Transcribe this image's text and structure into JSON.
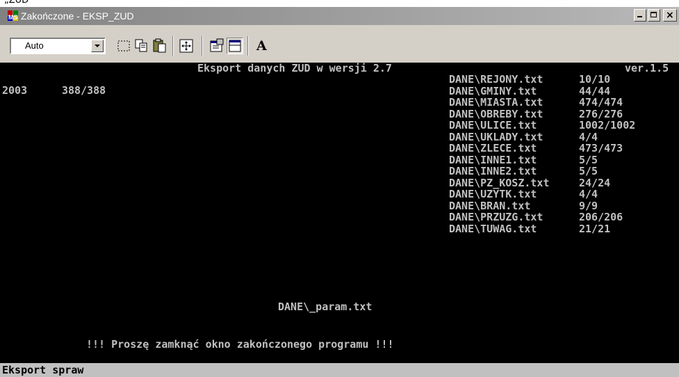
{
  "caption": "„ZUD",
  "window": {
    "title": "Zakończone - EKSP_ZUD",
    "minimize_glyph": "_",
    "maximize_glyph": "□",
    "close_glyph": "×",
    "app_icon": "ms-dos-icon"
  },
  "toolbar": {
    "font_size_value": "Auto",
    "dropdown_icon": "chevron-down-icon",
    "tools": [
      {
        "name": "mark-icon"
      },
      {
        "name": "copy-icon"
      },
      {
        "name": "paste-icon"
      },
      {
        "name": "fullscreen-icon"
      },
      {
        "name": "properties-icon"
      },
      {
        "name": "background-icon"
      },
      {
        "name": "font-icon",
        "glyph": "A"
      }
    ]
  },
  "console": {
    "header": "Eksport danych ZUD w wersji 2.7",
    "version": "ver.1.5",
    "year": "2003",
    "year_count": "388/388",
    "files": [
      {
        "name": "DANE\\REJONY.txt",
        "count": "10/10"
      },
      {
        "name": "DANE\\GMINY.txt",
        "count": "44/44"
      },
      {
        "name": "DANE\\MIASTA.txt",
        "count": "474/474"
      },
      {
        "name": "DANE\\OBREBY.txt",
        "count": "276/276"
      },
      {
        "name": "DANE\\ULICE.txt",
        "count": "1002/1002"
      },
      {
        "name": "DANE\\UKLADY.txt",
        "count": "4/4"
      },
      {
        "name": "DANE\\ZLECE.txt",
        "count": "473/473"
      },
      {
        "name": "DANE\\INNE1.txt",
        "count": "5/5"
      },
      {
        "name": "DANE\\INNE2.txt",
        "count": "5/5"
      },
      {
        "name": "DANE\\PZ_KOSZ.txt",
        "count": "24/24"
      },
      {
        "name": "DANE\\UZYTK.txt",
        "count": "4/4"
      },
      {
        "name": "DANE\\BRAN.txt",
        "count": "9/9"
      },
      {
        "name": "DANE\\PRZUZG.txt",
        "count": "206/206"
      },
      {
        "name": "DANE\\TUWAG.txt",
        "count": "21/21"
      }
    ],
    "param_file": "DANE\\_param.txt",
    "close_message": "!!! Proszę zamknąć okno zakończonego programu !!!"
  },
  "statusbar": {
    "text": "Eksport spraw"
  },
  "colors": {
    "console_bg": "#000000",
    "console_fg": "#c0c0c0",
    "titlebar_inactive": "#828282",
    "chrome": "#d4d0c8"
  }
}
